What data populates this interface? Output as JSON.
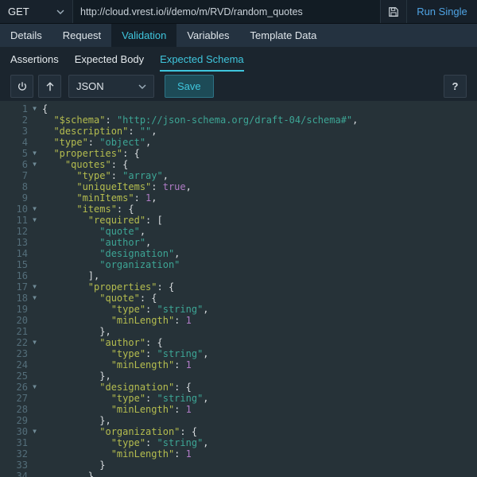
{
  "topbar": {
    "method": "GET",
    "url": "http://cloud.vrest.io/i/demo/m/RVD/random_quotes",
    "run_label": "Run Single"
  },
  "tabs": [
    {
      "label": "Details"
    },
    {
      "label": "Request"
    },
    {
      "label": "Validation"
    },
    {
      "label": "Variables"
    },
    {
      "label": "Template Data"
    }
  ],
  "active_tab": "Validation",
  "subtabs": [
    {
      "label": "Assertions"
    },
    {
      "label": "Expected Body"
    },
    {
      "label": "Expected Schema"
    }
  ],
  "active_subtab": "Expected Schema",
  "toolbar": {
    "mode": "JSON",
    "save_label": "Save",
    "help_label": "?"
  },
  "colors": {
    "accent": "#3fc6dd",
    "run-blue": "#4fa3e3",
    "editor-bg": "#263238",
    "gutter-fg": "#546e7a",
    "tok-key": "#b5bd4f",
    "tok-str": "#3da595",
    "tok-atom": "#b07cc6",
    "tok-punct": "#d9dde0"
  },
  "editor": {
    "lines": [
      {
        "n": 1,
        "fold": true,
        "t": [
          [
            "p",
            "{"
          ]
        ]
      },
      {
        "n": 2,
        "fold": false,
        "t": [
          [
            "k",
            "  \"$schema\""
          ],
          [
            "p",
            ": "
          ],
          [
            "s",
            "\"http://json-schema.org/draft-04/schema#\""
          ],
          [
            "p",
            ","
          ]
        ]
      },
      {
        "n": 3,
        "fold": false,
        "t": [
          [
            "k",
            "  \"description\""
          ],
          [
            "p",
            ": "
          ],
          [
            "s",
            "\"\""
          ],
          [
            "p",
            ","
          ]
        ]
      },
      {
        "n": 4,
        "fold": false,
        "t": [
          [
            "k",
            "  \"type\""
          ],
          [
            "p",
            ": "
          ],
          [
            "s",
            "\"object\""
          ],
          [
            "p",
            ","
          ]
        ]
      },
      {
        "n": 5,
        "fold": true,
        "t": [
          [
            "k",
            "  \"properties\""
          ],
          [
            "p",
            ": {"
          ]
        ]
      },
      {
        "n": 6,
        "fold": true,
        "t": [
          [
            "k",
            "    \"quotes\""
          ],
          [
            "p",
            ": {"
          ]
        ]
      },
      {
        "n": 7,
        "fold": false,
        "t": [
          [
            "k",
            "      \"type\""
          ],
          [
            "p",
            ": "
          ],
          [
            "s",
            "\"array\""
          ],
          [
            "p",
            ","
          ]
        ]
      },
      {
        "n": 8,
        "fold": false,
        "t": [
          [
            "k",
            "      \"uniqueItems\""
          ],
          [
            "p",
            ": "
          ],
          [
            "a",
            "true"
          ],
          [
            "p",
            ","
          ]
        ]
      },
      {
        "n": 9,
        "fold": false,
        "t": [
          [
            "k",
            "      \"minItems\""
          ],
          [
            "p",
            ": "
          ],
          [
            "a",
            "1"
          ],
          [
            "p",
            ","
          ]
        ]
      },
      {
        "n": 10,
        "fold": true,
        "t": [
          [
            "k",
            "      \"items\""
          ],
          [
            "p",
            ": {"
          ]
        ]
      },
      {
        "n": 11,
        "fold": true,
        "t": [
          [
            "k",
            "        \"required\""
          ],
          [
            "p",
            ": ["
          ]
        ]
      },
      {
        "n": 12,
        "fold": false,
        "t": [
          [
            "s",
            "          \"quote\""
          ],
          [
            "p",
            ","
          ]
        ]
      },
      {
        "n": 13,
        "fold": false,
        "t": [
          [
            "s",
            "          \"author\""
          ],
          [
            "p",
            ","
          ]
        ]
      },
      {
        "n": 14,
        "fold": false,
        "t": [
          [
            "s",
            "          \"designation\""
          ],
          [
            "p",
            ","
          ]
        ]
      },
      {
        "n": 15,
        "fold": false,
        "t": [
          [
            "s",
            "          \"organization\""
          ]
        ]
      },
      {
        "n": 16,
        "fold": false,
        "t": [
          [
            "p",
            "        ],"
          ]
        ]
      },
      {
        "n": 17,
        "fold": true,
        "t": [
          [
            "k",
            "        \"properties\""
          ],
          [
            "p",
            ": {"
          ]
        ]
      },
      {
        "n": 18,
        "fold": true,
        "t": [
          [
            "k",
            "          \"quote\""
          ],
          [
            "p",
            ": {"
          ]
        ]
      },
      {
        "n": 19,
        "fold": false,
        "t": [
          [
            "k",
            "            \"type\""
          ],
          [
            "p",
            ": "
          ],
          [
            "s",
            "\"string\""
          ],
          [
            "p",
            ","
          ]
        ]
      },
      {
        "n": 20,
        "fold": false,
        "t": [
          [
            "k",
            "            \"minLength\""
          ],
          [
            "p",
            ": "
          ],
          [
            "a",
            "1"
          ]
        ]
      },
      {
        "n": 21,
        "fold": false,
        "t": [
          [
            "p",
            "          },"
          ]
        ]
      },
      {
        "n": 22,
        "fold": true,
        "t": [
          [
            "k",
            "          \"author\""
          ],
          [
            "p",
            ": {"
          ]
        ]
      },
      {
        "n": 23,
        "fold": false,
        "t": [
          [
            "k",
            "            \"type\""
          ],
          [
            "p",
            ": "
          ],
          [
            "s",
            "\"string\""
          ],
          [
            "p",
            ","
          ]
        ]
      },
      {
        "n": 24,
        "fold": false,
        "t": [
          [
            "k",
            "            \"minLength\""
          ],
          [
            "p",
            ": "
          ],
          [
            "a",
            "1"
          ]
        ]
      },
      {
        "n": 25,
        "fold": false,
        "t": [
          [
            "p",
            "          },"
          ]
        ]
      },
      {
        "n": 26,
        "fold": true,
        "t": [
          [
            "k",
            "          \"designation\""
          ],
          [
            "p",
            ": {"
          ]
        ]
      },
      {
        "n": 27,
        "fold": false,
        "t": [
          [
            "k",
            "            \"type\""
          ],
          [
            "p",
            ": "
          ],
          [
            "s",
            "\"string\""
          ],
          [
            "p",
            ","
          ]
        ]
      },
      {
        "n": 28,
        "fold": false,
        "t": [
          [
            "k",
            "            \"minLength\""
          ],
          [
            "p",
            ": "
          ],
          [
            "a",
            "1"
          ]
        ]
      },
      {
        "n": 29,
        "fold": false,
        "t": [
          [
            "p",
            "          },"
          ]
        ]
      },
      {
        "n": 30,
        "fold": true,
        "t": [
          [
            "k",
            "          \"organization\""
          ],
          [
            "p",
            ": {"
          ]
        ]
      },
      {
        "n": 31,
        "fold": false,
        "t": [
          [
            "k",
            "            \"type\""
          ],
          [
            "p",
            ": "
          ],
          [
            "s",
            "\"string\""
          ],
          [
            "p",
            ","
          ]
        ]
      },
      {
        "n": 32,
        "fold": false,
        "t": [
          [
            "k",
            "            \"minLength\""
          ],
          [
            "p",
            ": "
          ],
          [
            "a",
            "1"
          ]
        ]
      },
      {
        "n": 33,
        "fold": false,
        "t": [
          [
            "p",
            "          }"
          ]
        ]
      },
      {
        "n": 34,
        "fold": false,
        "t": [
          [
            "p",
            "        }"
          ]
        ]
      }
    ]
  }
}
